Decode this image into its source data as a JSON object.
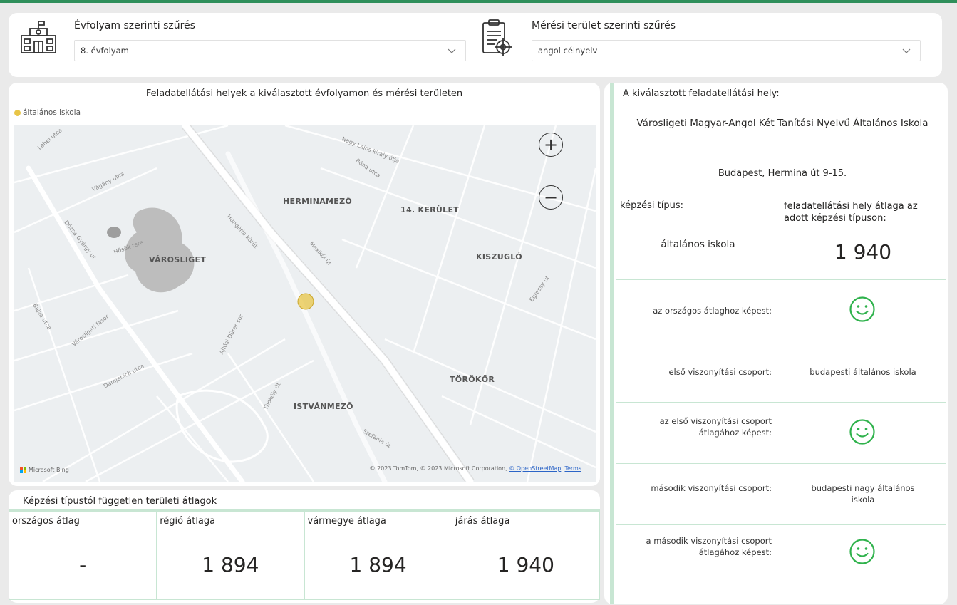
{
  "filters": {
    "grade": {
      "title": "Évfolyam szerinti szűrés",
      "value": "8. évfolyam",
      "icon": "school-building-icon"
    },
    "area": {
      "title": "Mérési terület szerinti szűrés",
      "value": "angol célnyelv",
      "icon": "clipboard-target-icon"
    }
  },
  "map": {
    "title": "Feladatellátási helyek a kiválasztott évfolyamon és mérési területen",
    "legend": "általános iskola",
    "legend_color": "#e8c547",
    "district_labels": [
      "HERMINAMEZŐ",
      "14. KERÜLET",
      "VÁROSLIGET",
      "KISZUGLÓ",
      "TÖRÖKŐR",
      "ISTVÁNMEZŐ"
    ],
    "street_labels": [
      "Lehel utca",
      "Vágány utca",
      "Dózsa György út",
      "Hungária körút",
      "Nagy Lajos király útja",
      "Róna utca",
      "Mexikói út",
      "Egressy út",
      "Ajtósi Dürer sor",
      "Thököly út",
      "Stefánia út",
      "Bajza utca",
      "Városligeti fasor",
      "Damjanich utca",
      "Hősök tere"
    ],
    "zoom_in": "+",
    "zoom_out": "−",
    "provider": "Microsoft Bing",
    "attribution": "© 2023 TomTom, © 2023 Microsoft Corporation, ",
    "osm_link": "© OpenStreetMap",
    "terms_link": "Terms"
  },
  "averages": {
    "title": "Képzési típustól független területi átlagok",
    "cells": [
      {
        "label": "országos átlag",
        "value": "-"
      },
      {
        "label": "régió átlaga",
        "value": "1 894"
      },
      {
        "label": "vármegye átlaga",
        "value": "1 894"
      },
      {
        "label": "járás átlaga",
        "value": "1 940"
      }
    ]
  },
  "selected": {
    "heading": "A kiválasztott feladatellátási hely:",
    "name": "Városligeti Magyar-Angol Két Tanítási Nyelvű Általános Iskola",
    "address": "Budapest, Hermina út 9-15.",
    "type_label": "képzési típus:",
    "type_value": "általános iskola",
    "avg_label": "feladatellátási hely átlaga az adott képzési típuson:",
    "avg_value": "1 940",
    "national_label": "az országos átlaghoz képest:",
    "group1_label": "első viszonyítási csoport:",
    "group1_value": "budapesti általános iskola",
    "group1_cmp_label": "az első viszonyítási csoport átlagához képest:",
    "group2_label": "második viszonyítási csoport:",
    "group2_value": "budapesti nagy általános iskola",
    "group2_cmp_label": "a második viszonyítási csoport átlagához képest:",
    "smiley_color": "#2fb24c"
  }
}
